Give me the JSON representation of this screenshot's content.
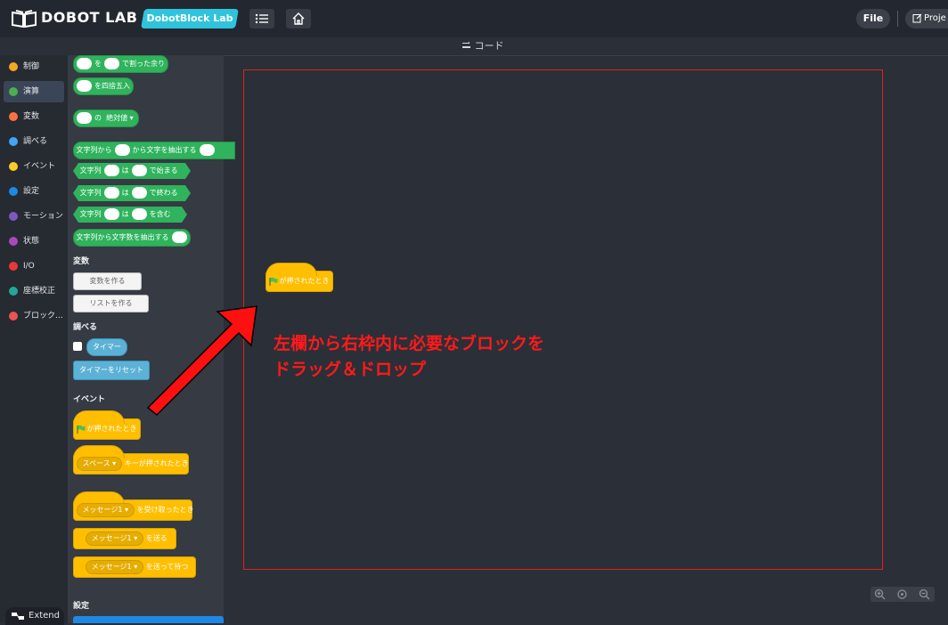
{
  "header": {
    "logo_text": "DOBOT LAB",
    "app_badge": "DobotBlock Lab",
    "file_label": "File",
    "project_label": "Proje"
  },
  "code_tab": "コード",
  "categories": [
    {
      "label": "制御",
      "color": "#f5a623"
    },
    {
      "label": "演算",
      "color": "#4caf50"
    },
    {
      "label": "変数",
      "color": "#ff7043"
    },
    {
      "label": "調べる",
      "color": "#42a5f5"
    },
    {
      "label": "イベント",
      "color": "#ffca28"
    },
    {
      "label": "設定",
      "color": "#1e88e5"
    },
    {
      "label": "モーション",
      "color": "#7e57c2"
    },
    {
      "label": "状態",
      "color": "#ab47bc"
    },
    {
      "label": "I/O",
      "color": "#e53935"
    },
    {
      "label": "座標校正",
      "color": "#26a69a"
    },
    {
      "label": "ブロック...",
      "color": "#ef5350"
    }
  ],
  "extend_label": "Extend",
  "palette": {
    "op_mod": {
      "a": "を",
      "b": "で割った余り"
    },
    "op_round": "を四捨五入",
    "op_abs": {
      "a": "の",
      "dd": "絶対値"
    },
    "str_sub": {
      "a": "文字列から",
      "b": "から文字を抽出する"
    },
    "str_starts": {
      "a": "文字列",
      "b": "は",
      "c": "で始まる"
    },
    "str_ends": {
      "a": "文字列",
      "b": "は",
      "c": "で終わる"
    },
    "str_contains": {
      "a": "文字列",
      "b": "は",
      "c": "を含む"
    },
    "str_len": "文字列から文字数を抽出する",
    "var_header": "変数",
    "make_var": "変数を作る",
    "make_list": "リストを作る",
    "sense_header": "調べる",
    "timer": "タイマー",
    "reset_timer": "タイマーをリセット",
    "event_header": "イベント",
    "flag_clicked": "が押されたとき",
    "key_space": "スペース",
    "key_pressed": "キーが押されたとき",
    "msg_name": "メッセージ1",
    "msg_received": "を受け取ったとき",
    "msg_send": "を送る",
    "msg_send_wait": "を送って待つ",
    "settings_header": "設定"
  },
  "canvas": {
    "placed_block": "が押されたとき",
    "instruction_line1": "左欄から右枠内に必要なブロックを",
    "instruction_line2": "ドラッグ＆ドロップ"
  }
}
